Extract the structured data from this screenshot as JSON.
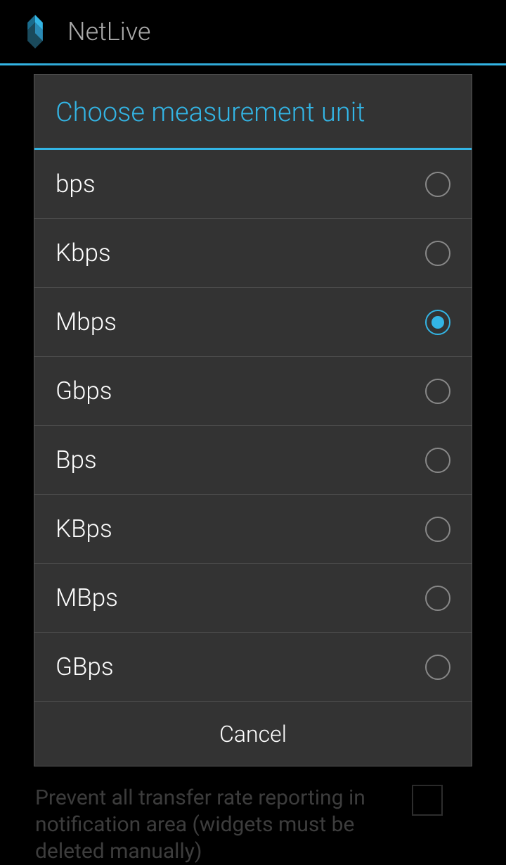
{
  "app": {
    "title": "NetLive"
  },
  "dialog": {
    "title": "Choose measurement unit",
    "options": [
      {
        "label": "bps",
        "selected": false
      },
      {
        "label": "Kbps",
        "selected": false
      },
      {
        "label": "Mbps",
        "selected": true
      },
      {
        "label": "Gbps",
        "selected": false
      },
      {
        "label": "Bps",
        "selected": false
      },
      {
        "label": "KBps",
        "selected": false
      },
      {
        "label": "MBps",
        "selected": false
      },
      {
        "label": "GBps",
        "selected": false
      }
    ],
    "cancel_label": "Cancel"
  },
  "background": {
    "setting_text": "Prevent all transfer rate reporting in notification area (widgets must be deleted manually)"
  },
  "colors": {
    "accent": "#33b5e5",
    "dialog_bg": "#333333"
  }
}
